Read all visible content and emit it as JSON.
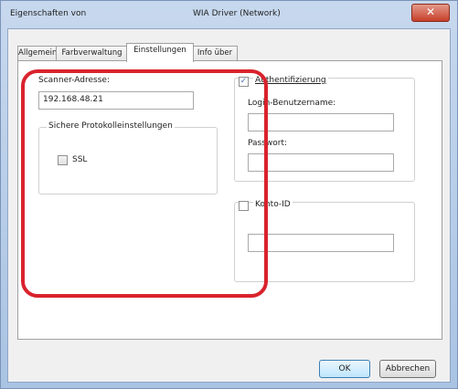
{
  "window": {
    "title_left": "Eigenschaften von",
    "title_center": "WIA Driver (Network)",
    "close_glyph": "✕"
  },
  "tabs": [
    {
      "label": "Allgemein"
    },
    {
      "label": "Farbverwaltung"
    },
    {
      "label": "Einstellungen"
    },
    {
      "label": "Info über"
    }
  ],
  "settings": {
    "scanner_address_label": "Scanner-Adresse:",
    "scanner_address_value": "192.168.48.21",
    "secure_group_title": "Sichere Protokolleinstellungen",
    "ssl_label": "SSL",
    "ssl_checked": false,
    "auth_label": "Authentifizierung",
    "auth_checked": true,
    "login_label": "Login-Benutzername:",
    "login_value": "",
    "password_label": "Passwort:",
    "password_value": "",
    "konto_label": "Konto-ID",
    "konto_checked": false,
    "konto_value": ""
  },
  "buttons": {
    "ok": "OK",
    "cancel": "Abbrechen"
  },
  "colors": {
    "highlight": "#d9232d",
    "titlebar": "#b8cde8"
  }
}
